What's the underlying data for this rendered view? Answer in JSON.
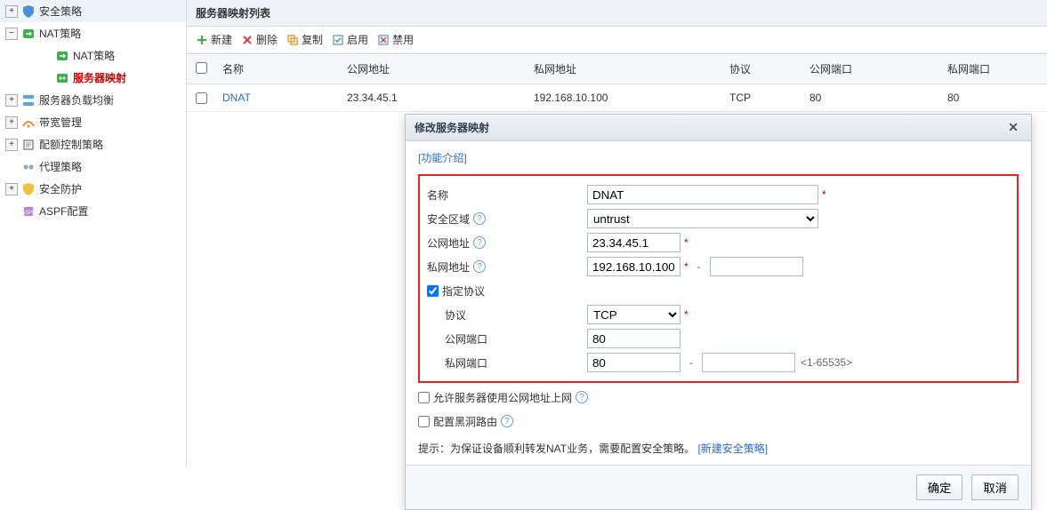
{
  "sidebar": {
    "items": [
      {
        "label": "安全策略",
        "expander": "+"
      },
      {
        "label": "NAT策略",
        "expander": "−"
      },
      {
        "label": "NAT策略",
        "expander": ""
      },
      {
        "label": "服务器映射",
        "expander": ""
      },
      {
        "label": "服务器负载均衡",
        "expander": "+"
      },
      {
        "label": "带宽管理",
        "expander": "+"
      },
      {
        "label": "配额控制策略",
        "expander": "+"
      },
      {
        "label": "代理策略",
        "expander": ""
      },
      {
        "label": "安全防护",
        "expander": "+"
      },
      {
        "label": "ASPF配置",
        "expander": ""
      }
    ]
  },
  "panel": {
    "title": "服务器映射列表"
  },
  "toolbar": {
    "new": "新建",
    "delete": "删除",
    "copy": "复制",
    "enable": "启用",
    "disable": "禁用"
  },
  "grid": {
    "headers": {
      "name": "名称",
      "pubip": "公网地址",
      "privip": "私网地址",
      "proto": "协议",
      "pubport": "公网端口",
      "privport": "私网端口"
    },
    "rows": [
      {
        "name": "DNAT",
        "pubip": "23.34.45.1",
        "privip": "192.168.10.100",
        "proto": "TCP",
        "pubport": "80",
        "privport": "80"
      }
    ]
  },
  "dialog": {
    "title": "修改服务器映射",
    "func_intro": "[功能介绍]",
    "labels": {
      "name": "名称",
      "zone": "安全区域",
      "pubip": "公网地址",
      "privip": "私网地址",
      "spec_proto": "指定协议",
      "proto": "协议",
      "pubport": "公网端口",
      "privport": "私网端口",
      "allow_pub": "允许服务器使用公网地址上网",
      "blackhole": "配置黑洞路由"
    },
    "values": {
      "name": "DNAT",
      "zone": "untrust",
      "pubip": "23.34.45.1",
      "privip_start": "192.168.10.100",
      "privip_end": "",
      "proto": "TCP",
      "pubport": "80",
      "privport_start": "80",
      "privport_end": "",
      "spec_proto_checked": true,
      "allow_pub_checked": false,
      "blackhole_checked": false
    },
    "range_hint": "<1-65535>",
    "tip_prefix": "提示：为保证设备顺利转发NAT业务，需要配置安全策略。",
    "tip_link": "[新建安全策略]",
    "ok": "确定",
    "cancel": "取消"
  },
  "icons": {
    "colors": {
      "security": "#4a90d9",
      "nat": "#3fae4d",
      "lb": "#5aa7e6",
      "bw": "#e88f2f",
      "quota": "#8a8a8a",
      "proxy": "#8aa8c9",
      "defense": "#f0c040",
      "aspf": "#b983d4",
      "plus": "#3aae3a",
      "x": "#d04040",
      "copy": "#e6a03a",
      "doc": "#5a8fd6"
    }
  }
}
